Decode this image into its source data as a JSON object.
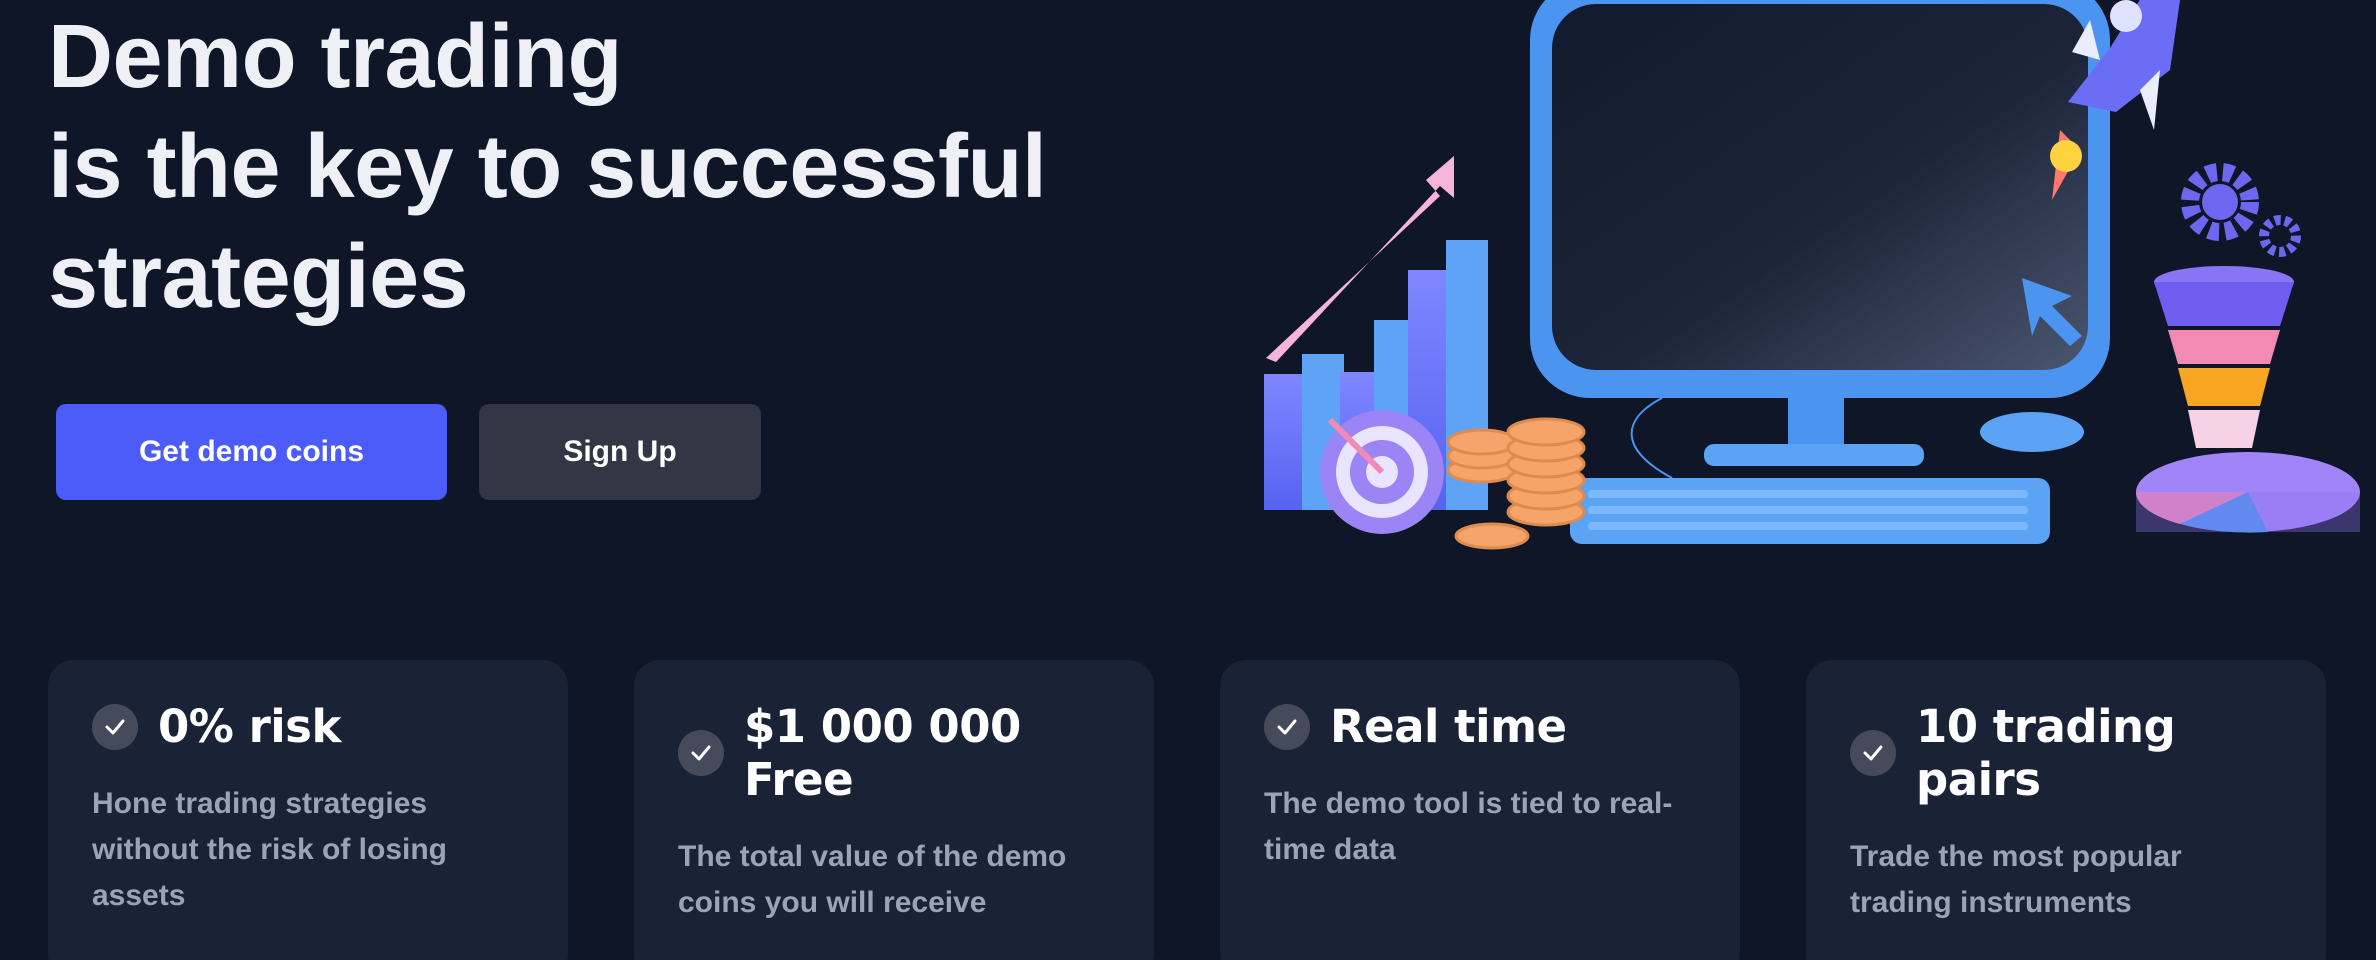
{
  "hero": {
    "title_lines": [
      "Demo trading",
      "is the key to successful",
      "strategies"
    ],
    "primary_button": "Get demo coins",
    "secondary_button": "Sign Up"
  },
  "features": [
    {
      "title": "0% risk",
      "description": "Hone trading strategies without the risk of losing assets",
      "icon": "check-icon"
    },
    {
      "title": "$1 000 000 Free",
      "description": "The total value of the demo coins you will receive",
      "icon": "check-icon"
    },
    {
      "title": "Real time",
      "description": "The demo tool is tied to real-time data",
      "icon": "check-icon"
    },
    {
      "title": "10 trading pairs",
      "description": "Trade the most popular trading instruments",
      "icon": "check-icon"
    }
  ],
  "colors": {
    "background": "#0e1628",
    "primary": "#4b5cf8",
    "secondary": "#333644",
    "card": "#1a2236",
    "monitor": "#4b95f0"
  }
}
